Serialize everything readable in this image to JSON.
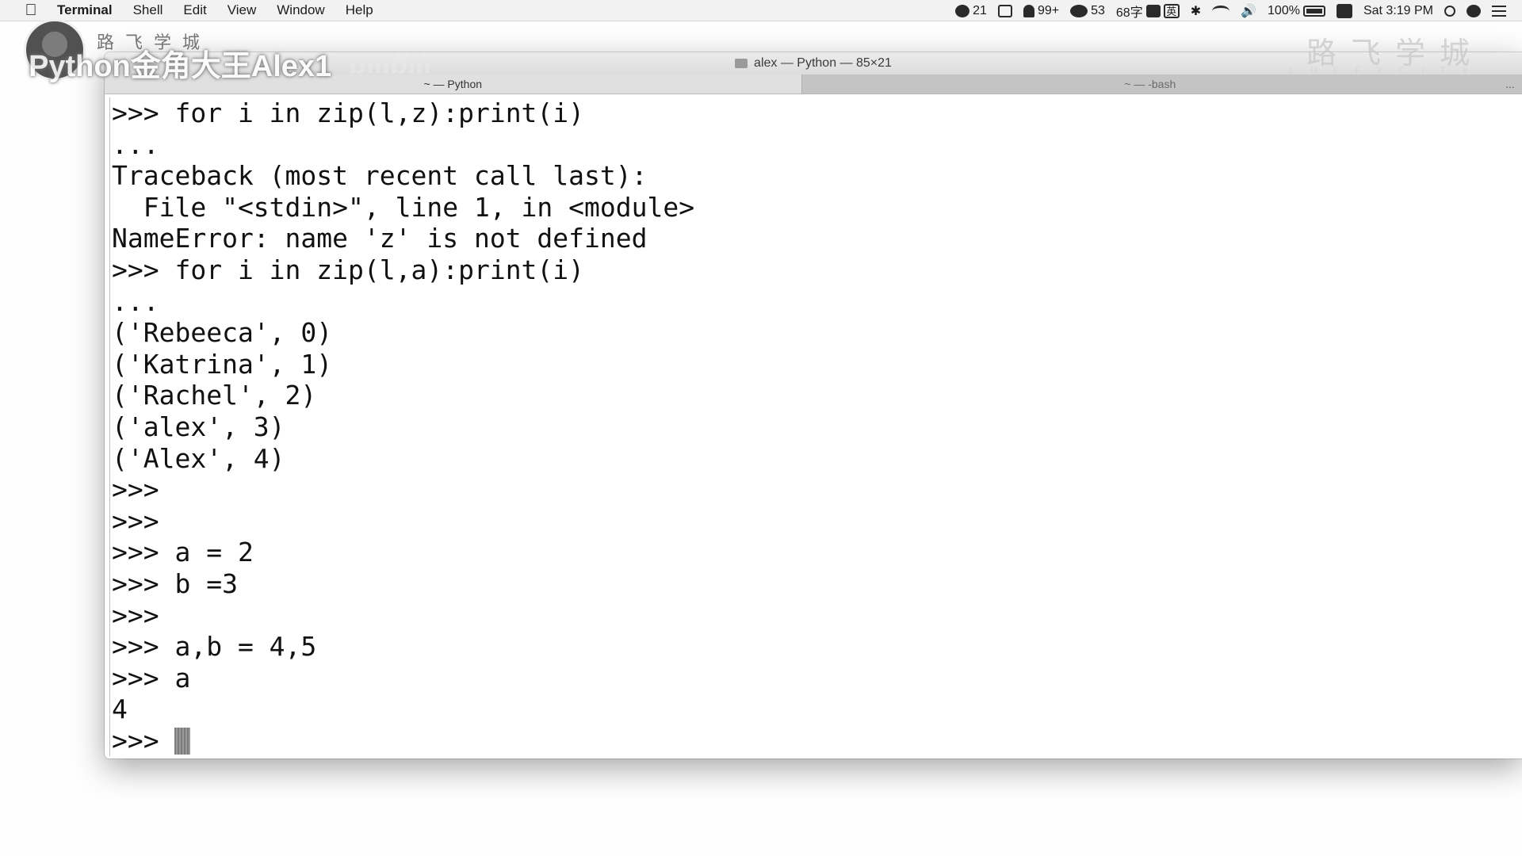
{
  "menubar": {
    "app_name": "Terminal",
    "items": [
      "Shell",
      "Edit",
      "View",
      "Window",
      "Help"
    ],
    "status": {
      "notif1": "21",
      "notif2": "99+",
      "wechat": "53",
      "input_count": "68字",
      "input_lang": "英",
      "battery": "100%",
      "clock": "Sat 3:19 PM"
    }
  },
  "overlay": {
    "small_brand": "路飞学城",
    "big_text": "Python金角大王Alex1",
    "bili": "bilibili",
    "right_brand": "路飞学城",
    "right_sub": "LUFFYCITY"
  },
  "window": {
    "title": "alex — Python — 85×21",
    "tabs": [
      {
        "label": "~ — Python",
        "active": true
      },
      {
        "label": "~ — -bash",
        "active": false
      }
    ],
    "tab_extra": "..."
  },
  "console": {
    "lines": [
      ">>> for i in zip(l,z):print(i)",
      "...",
      "Traceback (most recent call last):",
      "  File \"<stdin>\", line 1, in <module>",
      "NameError: name 'z' is not defined",
      ">>> for i in zip(l,a):print(i)",
      "...",
      "('Rebeeca', 0)",
      "('Katrina', 1)",
      "('Rachel', 2)",
      "('alex', 3)",
      "('Alex', 4)",
      ">>>",
      ">>>",
      ">>> a = 2",
      ">>> b =3",
      ">>>",
      ">>> a,b = 4,5",
      ">>> a",
      "4"
    ],
    "prompt": ">>> "
  }
}
